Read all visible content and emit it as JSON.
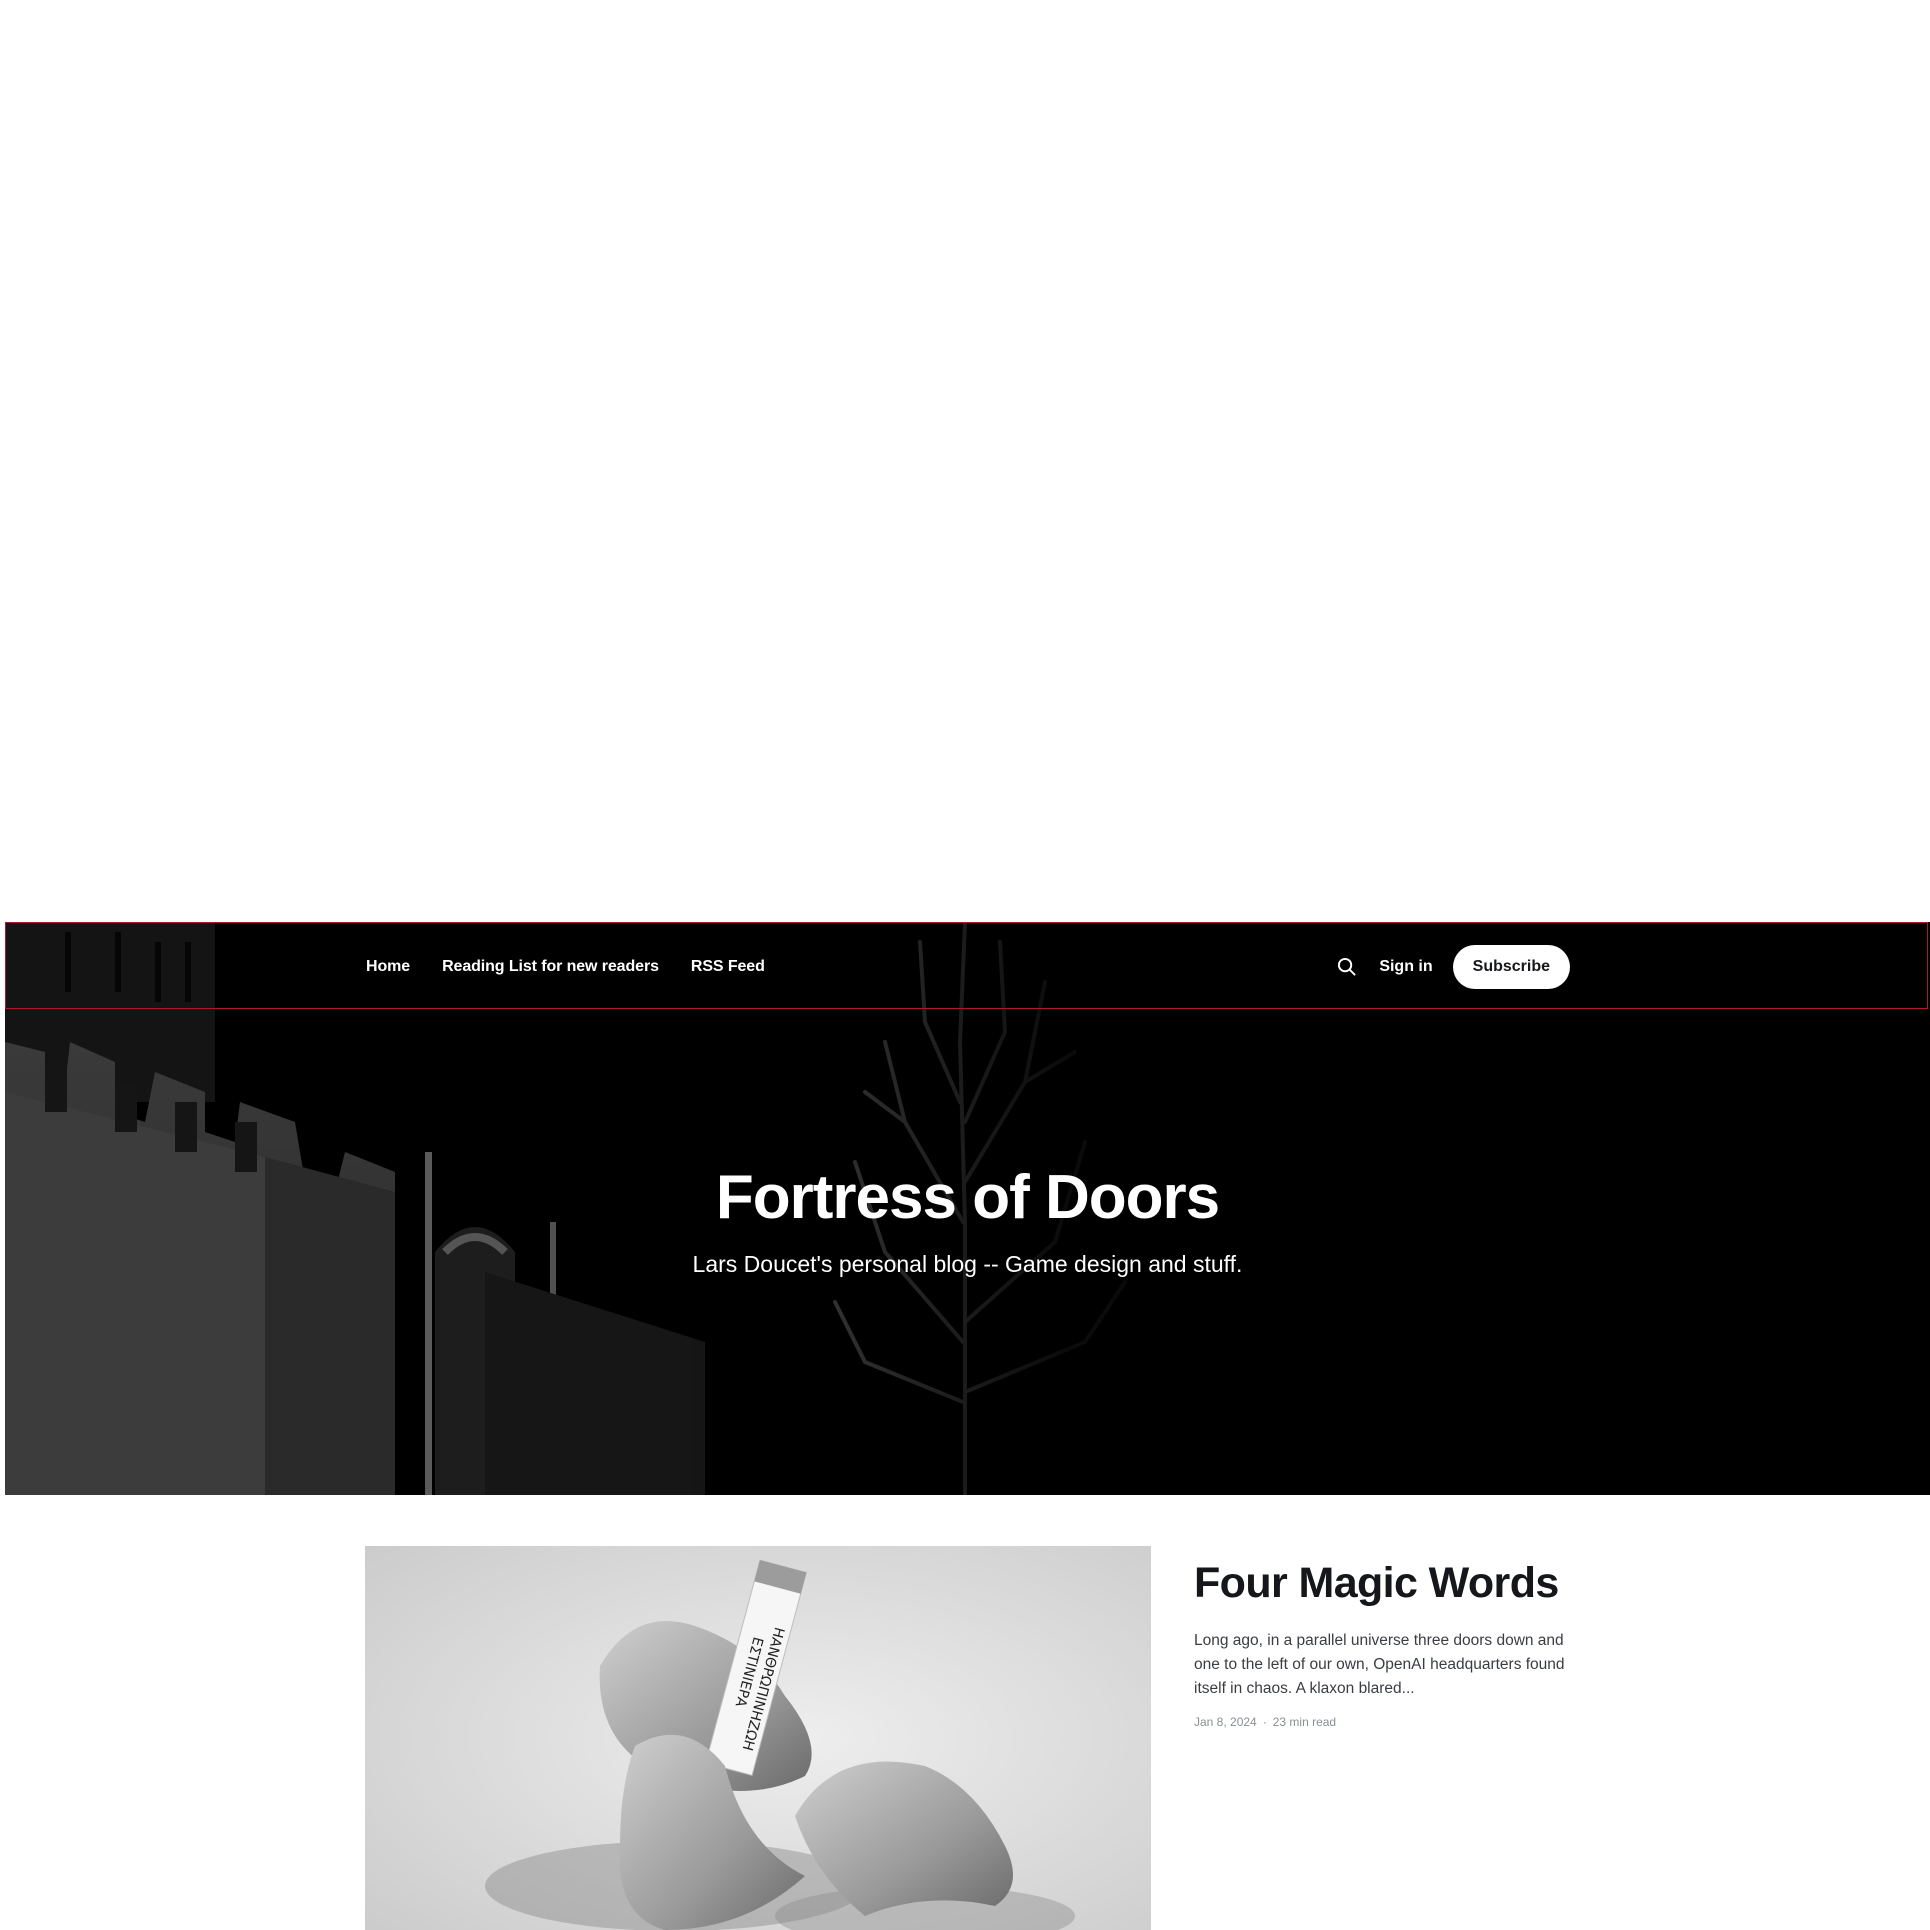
{
  "nav": {
    "items": [
      {
        "label": "Home"
      },
      {
        "label": "Reading List for new readers"
      },
      {
        "label": "RSS Feed"
      }
    ]
  },
  "actions": {
    "search_icon": "search-icon",
    "sign_in_label": "Sign in",
    "subscribe_label": "Subscribe"
  },
  "hero": {
    "title": "Fortress of Doors",
    "description": "Lars Doucet's personal blog -- Game design and stuff."
  },
  "featured_post": {
    "title": "Four Magic Words",
    "excerpt": "Long ago, in a parallel universe three doors down and one to the left of our own, OpenAI headquarters found itself in chaos. A klaxon blared...",
    "date": "Jan 8, 2024",
    "reading_time": "23 min read",
    "image_caption": "ΗΑΝΘΡΩΠΙΝΗΖΩΗ ΕΣΤΙΝΙΕΡΑ"
  },
  "colors": {
    "hero_background": "#000000",
    "topbar_border": "#b1162a",
    "title_text": "#15171a",
    "meta_text": "#8a8f96"
  }
}
